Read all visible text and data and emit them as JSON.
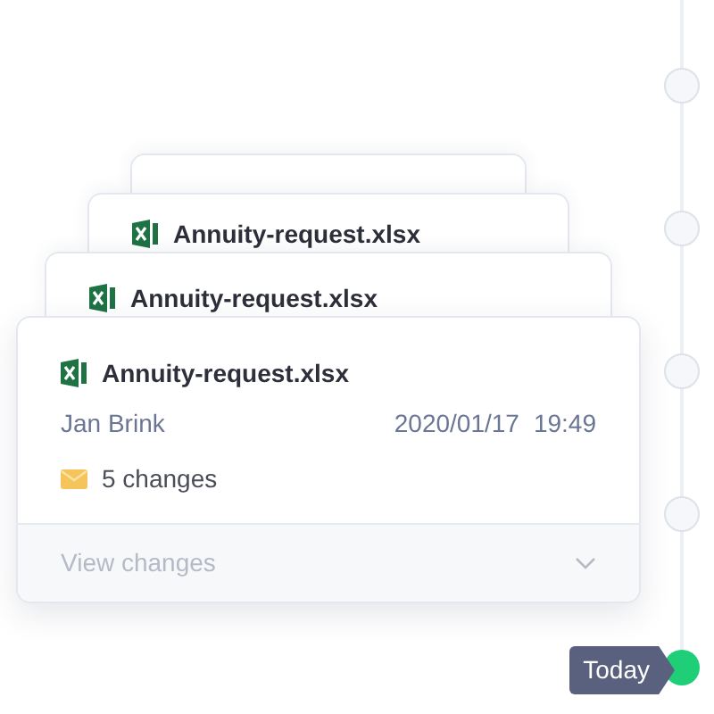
{
  "cards": [
    {
      "kind": "back"
    },
    {
      "kind": "back",
      "title": "Annuity-request.xlsx"
    },
    {
      "kind": "back",
      "title": "Annuity-request.xlsx"
    },
    {
      "kind": "front",
      "title": "Annuity-request.xlsx",
      "author": "Jan Brink",
      "date": "2020/01/17",
      "time": "19:49",
      "changes": "5 changes",
      "footer": "View changes",
      "expanded": false
    }
  ],
  "timeline": [
    {
      "kind": "past"
    },
    {
      "kind": "past"
    },
    {
      "kind": "past"
    },
    {
      "kind": "past"
    },
    {
      "kind": "today",
      "label": "Today"
    }
  ]
}
